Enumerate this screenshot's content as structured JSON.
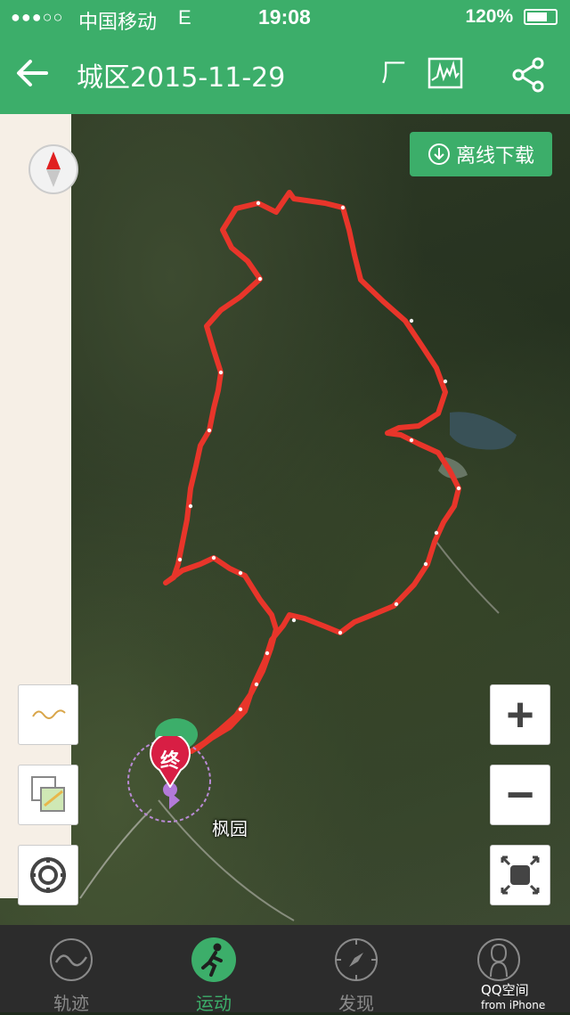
{
  "status_bar": {
    "signal": "●●●○○",
    "carrier": "中国移动",
    "network": "E",
    "time": "19:08",
    "battery_text": "120%"
  },
  "nav": {
    "title": "城区2015-11-29",
    "mini_label": "厂",
    "back_icon": "back-arrow-icon",
    "chart_icon": "elevation-chart-icon",
    "share_icon": "share-icon"
  },
  "map": {
    "offline_button": "离线下载",
    "place_label": "枫园",
    "end_marker": "终",
    "track_color": "#e8352a",
    "tools": [
      "track-style-icon",
      "layers-icon",
      "locate-icon"
    ],
    "zoom_in": "+",
    "zoom_out": "−"
  },
  "tabs": [
    {
      "label": "轨迹",
      "icon": "track-icon",
      "active": false
    },
    {
      "label": "运动",
      "icon": "run-icon",
      "active": true
    },
    {
      "label": "发现",
      "icon": "compass-icon",
      "active": false
    },
    {
      "label": "",
      "icon": "profile-icon",
      "active": false
    }
  ],
  "watermark": {
    "title": "QQ空间",
    "sub": "from iPhone"
  },
  "colors": {
    "brand_green": "#3cae6a",
    "track_red": "#e8352a",
    "end_marker": "#d81e44"
  }
}
